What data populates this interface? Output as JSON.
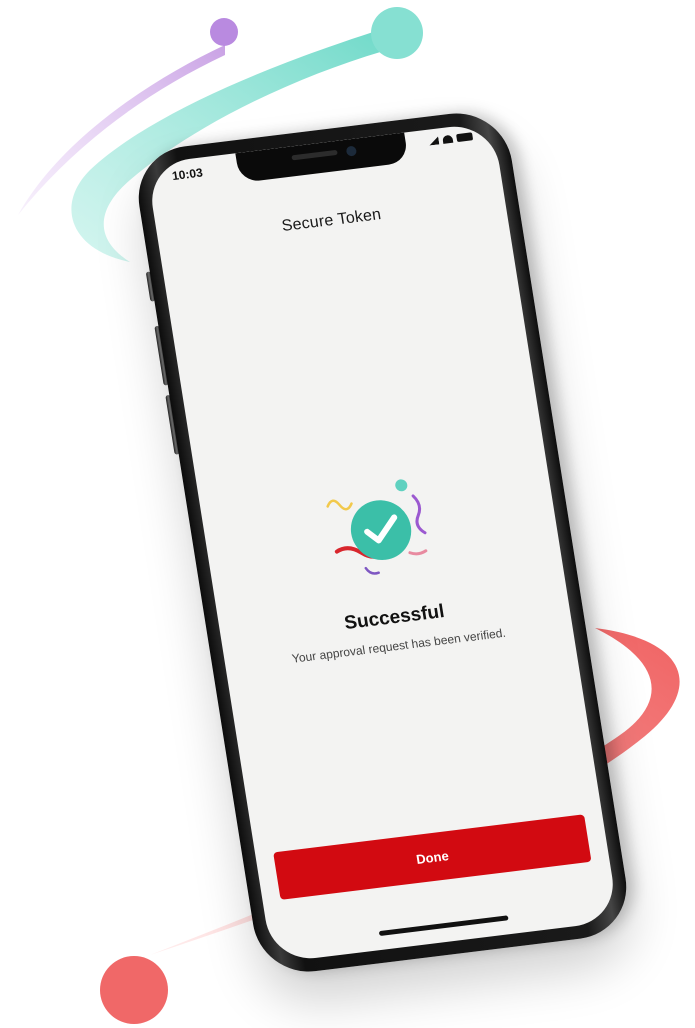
{
  "status_bar": {
    "time": "10:03"
  },
  "screen": {
    "title": "Secure Token",
    "result_title": "Successful",
    "result_message": "Your approval request has been verified.",
    "done_label": "Done"
  },
  "icons": {
    "status": [
      "signal-icon",
      "wifi-icon",
      "battery-icon"
    ],
    "result": "check-circle-icon"
  },
  "colors": {
    "accent_red": "#d20a11",
    "teal": "#3bbfa8",
    "purple": "#b27ad9",
    "coral": "#f06a6a"
  }
}
